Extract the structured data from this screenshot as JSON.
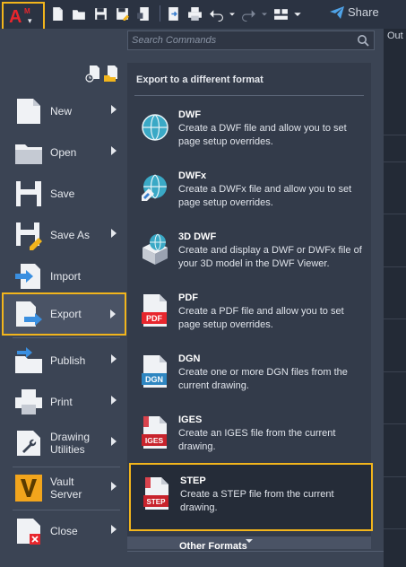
{
  "app": {
    "logo_letter": "A",
    "logo_sub": "M",
    "logo_caret": "▾"
  },
  "toolbar": {
    "icons": [
      "new-icon",
      "open-icon",
      "save-icon",
      "save-as-icon",
      "save-to-web-icon",
      "open-from-web-icon",
      "plot-icon",
      "undo-icon",
      "redo-icon",
      "workspace-icon",
      "dropdown-icon"
    ],
    "share_label": "Share"
  },
  "background": {
    "tab_partial": "Out"
  },
  "search": {
    "placeholder": "Search Commands"
  },
  "menu_items": [
    {
      "label": "New",
      "icon": "new-document-icon",
      "arrow": true
    },
    {
      "label": "Open",
      "icon": "open-folder-icon",
      "arrow": true
    },
    {
      "label": "Save",
      "icon": "save-disk-icon",
      "arrow": false
    },
    {
      "label": "Save As",
      "icon": "save-as-disk-icon",
      "arrow": true
    },
    {
      "label": "Import",
      "icon": "import-icon",
      "arrow": false
    },
    {
      "label": "Export",
      "icon": "export-icon",
      "arrow": true,
      "selected": true
    },
    {
      "label": "Publish",
      "icon": "publish-icon",
      "arrow": true
    },
    {
      "label": "Print",
      "icon": "printer-icon",
      "arrow": true
    },
    {
      "label": "Drawing Utilities",
      "icon": "wrench-icon",
      "arrow": true
    },
    {
      "label": "Vault Server",
      "icon": "vault-icon",
      "arrow": true
    },
    {
      "label": "Close",
      "icon": "close-document-icon",
      "arrow": true
    }
  ],
  "export_panel": {
    "title": "Export to a different format",
    "formats": [
      {
        "name": "DWF",
        "desc": "Create a DWF file and allow you to set page setup overrides.",
        "icon": "dwf-globe-icon"
      },
      {
        "name": "DWFx",
        "desc": "Create a DWFx file and allow you to set page setup overrides.",
        "icon": "dwfx-globe-icon"
      },
      {
        "name": "3D DWF",
        "desc": "Create and display a DWF or DWFx file of your 3D model in the DWF Viewer.",
        "icon": "3d-dwf-icon"
      },
      {
        "name": "PDF",
        "desc": "Create a PDF file and allow you to set page setup overrides.",
        "icon": "pdf-file-icon",
        "badge": "PDF"
      },
      {
        "name": "DGN",
        "desc": "Create one or more DGN files from the current drawing.",
        "icon": "dgn-file-icon",
        "badge": "DGN"
      },
      {
        "name": "IGES",
        "desc": "Create an IGES file from the current drawing.",
        "icon": "iges-file-icon",
        "badge": "IGES"
      },
      {
        "name": "STEP",
        "desc": "Create a STEP file from the current drawing.",
        "icon": "step-file-icon",
        "badge": "STEP",
        "selected": true
      }
    ],
    "more_label": "Other Formats"
  },
  "colors": {
    "highlight": "#f2b51c",
    "panel": "#333b4a",
    "menu": "#3b4454",
    "accent_red": "#e8262d"
  }
}
